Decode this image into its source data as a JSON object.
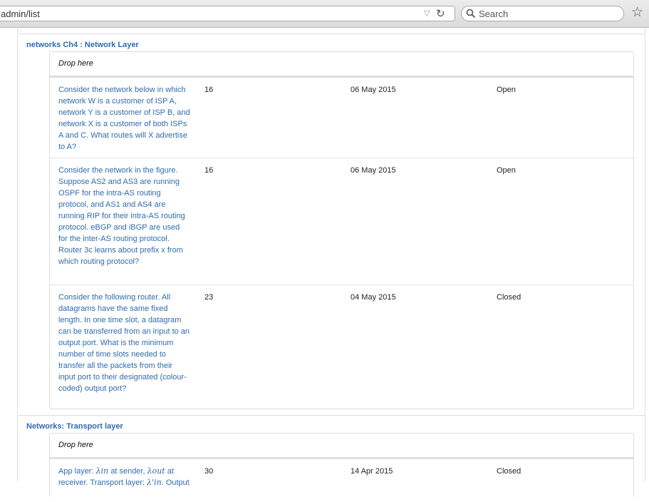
{
  "browser": {
    "url": "admin/list",
    "search_placeholder": "Search",
    "icons": [
      "dropdown-arrow-icon",
      "reload-icon",
      "search-icon",
      "bookmark-star-icon"
    ]
  },
  "categories": [
    {
      "title": "networks Ch4 : Network Layer",
      "drop_label": "Drop here",
      "rows": [
        {
          "question": "Consider the network below in which network W is a customer of ISP A, network Y is a customer of ISP B, and network X is a customer of both ISPs A and C. What routes will X advertise to A?",
          "count": "16",
          "date": "06 May 2015",
          "status": "Open"
        },
        {
          "question": "Consider the network in the figure. Suppose AS2 and AS3 are running OSPF for the intra-AS routing protocol, and AS1 and AS4 are running RIP for their intra-AS routing protocol. eBGP and iBGP are used for the inter-AS routing protocol. Router 3c learns about prefix x from which routing protocol?",
          "count": "16",
          "date": "06 May 2015",
          "status": "Open"
        },
        {
          "question": "Consider the following router. All datagrams have the same fixed length. In one time slot, a datagram can be transferred from an input to an output port. What is the minimum number of time slots needed to transfer all the packets from their input port to their designated (colour-coded) output port?",
          "count": "23",
          "date": "04 May 2015",
          "status": "Closed"
        }
      ]
    },
    {
      "title": "Networks: Transport layer",
      "drop_label": "Drop here",
      "rows": [
        {
          "question_parts": [
            "App layer: ",
            "λin",
            " at sender, ",
            "λout",
            " at receiver. Transport layer: ",
            "λ'in",
            ". Output"
          ],
          "count": "30",
          "date": "14 Apr 2015",
          "status": "Closed"
        }
      ]
    }
  ]
}
